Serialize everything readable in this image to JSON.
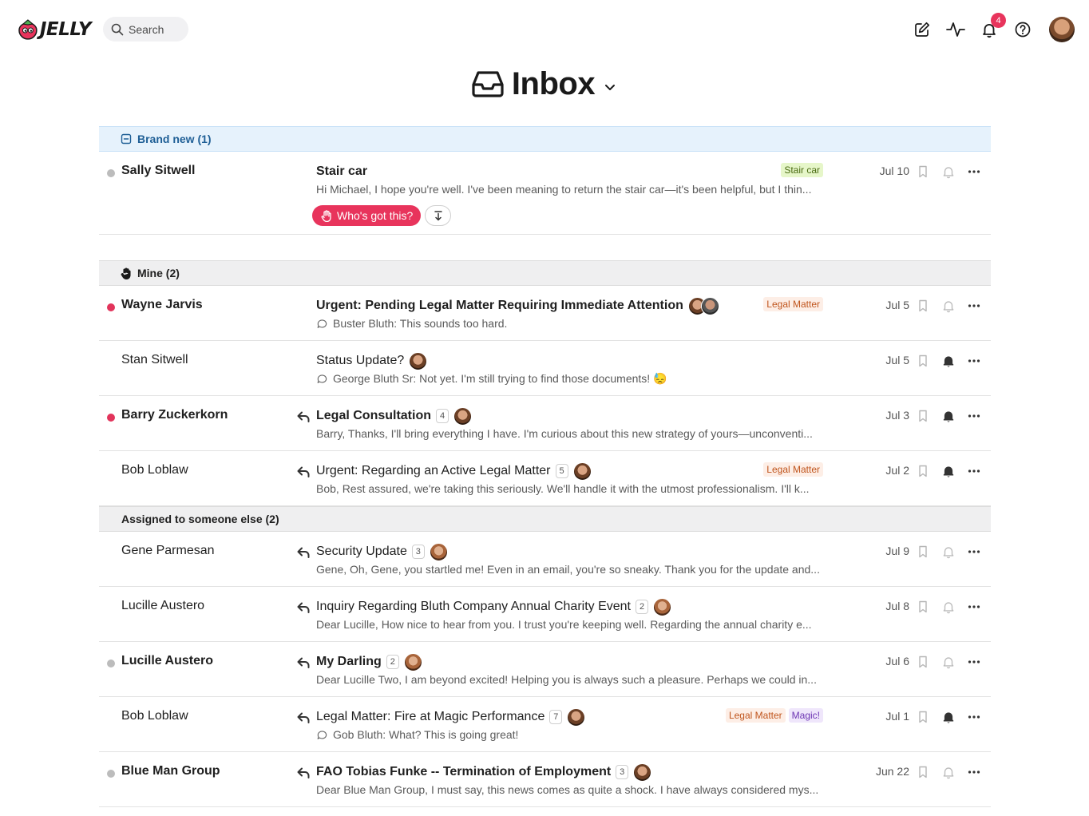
{
  "app": {
    "logo_text": "JELLY"
  },
  "search": {
    "label": "Search"
  },
  "header": {
    "notification_count": "4",
    "title": "Inbox"
  },
  "colors": {
    "accent": "#e8345c",
    "new_section_bg": "#e6f2fc"
  },
  "sections": {
    "brand_new": {
      "label": "Brand new (1)",
      "rows": [
        {
          "sender": "Sally Sitwell",
          "subject": "Stair car",
          "preview": "Hi Michael, I hope you're well. I've been meaning to return the stair car—it's been helpful, but I thin...",
          "tag": "Stair car",
          "date": "Jul 10",
          "claim_label": "Who's got this?"
        }
      ]
    },
    "mine": {
      "label": "Mine (2)",
      "rows": [
        {
          "sender": "Wayne Jarvis",
          "subject": "Urgent: Pending Legal Matter Requiring Immediate Attention",
          "preview": "Buster Bluth: This sounds too hard.",
          "tag": "Legal Matter",
          "date": "Jul 5"
        },
        {
          "sender": "Stan Sitwell",
          "subject": "Status Update?",
          "preview": "George Bluth Sr: Not yet. I'm still trying to find those documents! 😓",
          "date": "Jul 5"
        },
        {
          "sender": "Barry Zuckerkorn",
          "subject": "Legal Consultation",
          "count": "4",
          "preview": "Barry, Thanks, I'll bring everything I have. I'm curious about this new strategy of yours—unconventi...",
          "date": "Jul 3"
        },
        {
          "sender": "Bob Loblaw",
          "subject": "Urgent: Regarding an Active Legal Matter",
          "count": "5",
          "preview": "Bob, Rest assured, we're taking this seriously. We'll handle it with the utmost professionalism. I'll k...",
          "tag": "Legal Matter",
          "date": "Jul 2"
        }
      ]
    },
    "assigned": {
      "label": "Assigned to someone else (2)",
      "rows": [
        {
          "sender": "Gene Parmesan",
          "subject": "Security Update",
          "count": "3",
          "preview": "Gene, Oh, Gene, you startled me! Even in an email, you're so sneaky. Thank you for the update and...",
          "date": "Jul 9"
        },
        {
          "sender": "Lucille Austero",
          "subject": "Inquiry Regarding Bluth Company Annual Charity Event",
          "count": "2",
          "preview": "Dear Lucille, How nice to hear from you. I trust you're keeping well. Regarding the annual charity e...",
          "date": "Jul 8"
        },
        {
          "sender": "Lucille Austero",
          "subject": "My Darling",
          "count": "2",
          "preview": "Dear Lucille Two, I am beyond excited! Helping you is always such a pleasure. Perhaps we could in...",
          "date": "Jul 6"
        },
        {
          "sender": "Bob Loblaw",
          "subject": "Legal Matter: Fire at Magic Performance",
          "count": "7",
          "preview": "Gob Bluth: What? This is going great!",
          "tag": "Legal Matter",
          "tag2": "Magic!",
          "date": "Jul 1"
        },
        {
          "sender": "Blue Man Group",
          "subject": "FAO Tobias Funke -- Termination of Employment",
          "count": "3",
          "preview": "Dear Blue Man Group, I must say, this news comes as quite a shock. I have always considered mys...",
          "date": "Jun 22"
        }
      ]
    }
  }
}
